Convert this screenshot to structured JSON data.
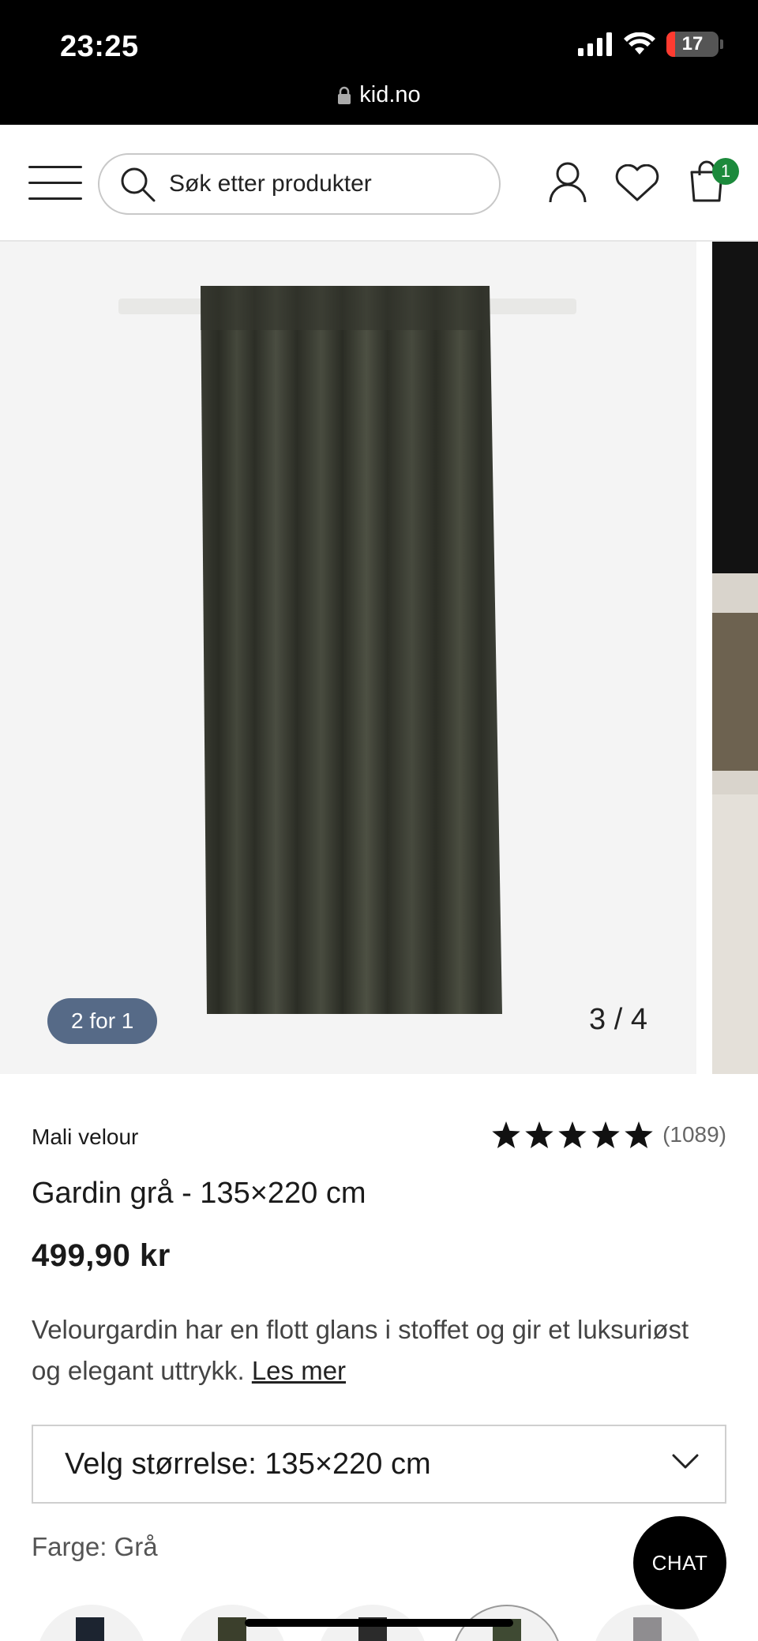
{
  "status_bar": {
    "time": "23:25",
    "battery": "17",
    "battery_level": 0.17,
    "url": "kid.no",
    "icons": [
      "signal-icon",
      "wifi-icon",
      "battery-icon",
      "lock-icon"
    ]
  },
  "header": {
    "search_placeholder": "Søk etter produkter",
    "cart_count": "1",
    "icons": [
      "menu-icon",
      "search-icon",
      "user-icon",
      "heart-icon",
      "cart-icon"
    ]
  },
  "gallery": {
    "promo_badge": "2 for 1",
    "counter": "3 / 4"
  },
  "product": {
    "brand": "Mali velour",
    "rating_stars": 5,
    "rating_count": "(1089)",
    "title": "Gardin grå - 135×220 cm",
    "price": "499,90 kr",
    "description": "Velourgardin har en flott glans i stoffet og gir et luksuriøst og elegant uttrykk.",
    "read_more": "Les mer",
    "size_select": "Velg størrelse: 135×220 cm",
    "color_label": "Farge:",
    "color_value": "Grå"
  },
  "chat": {
    "label": "CHAT"
  },
  "colors": {
    "badge_bg": "#566a87",
    "cart_badge": "#1c8a3c",
    "battery_red": "#ff3b30",
    "swatch_colors": [
      "#1c2430",
      "#3b3f2c",
      "#2b2b2b",
      "#3f4a33",
      "#8f8d90"
    ]
  }
}
